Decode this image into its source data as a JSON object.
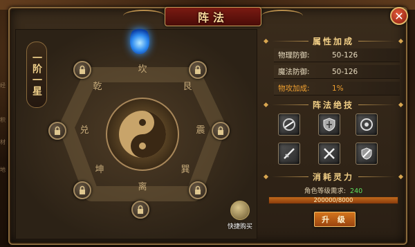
{
  "window": {
    "title": "阵法",
    "close_label": "✕"
  },
  "rank": {
    "label": "一阶一星"
  },
  "formation": {
    "trigrams": [
      "坎",
      "艮",
      "震",
      "巽",
      "离",
      "坤",
      "兑",
      "乾"
    ]
  },
  "attributes": {
    "heading": "属性加成",
    "rows": [
      {
        "label": "物理防御:",
        "value": "50-126"
      },
      {
        "label": "魔法防御:",
        "value": "50-126"
      },
      {
        "label": "物攻加成:",
        "value": "1%"
      }
    ]
  },
  "skills": {
    "heading": "阵法绝技",
    "items": [
      "skill-1",
      "skill-2",
      "skill-3",
      "skill-4",
      "skill-5",
      "skill-6"
    ]
  },
  "cost": {
    "heading": "消耗灵力",
    "req_label": "角色等级需求:",
    "req_value": "240",
    "progress_text": "200000/8000",
    "progress": 1.0,
    "upgrade_label": "升 级"
  },
  "quick_buy": {
    "label": "快捷购买"
  },
  "edge_labels": [
    "经",
    "积",
    "材",
    "地"
  ]
}
